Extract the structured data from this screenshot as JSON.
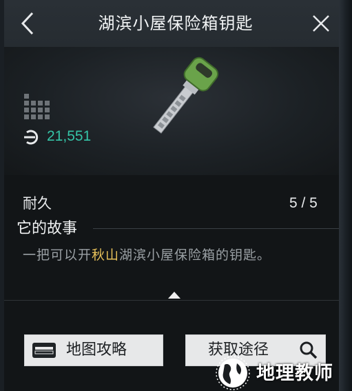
{
  "header": {
    "title": "湖滨小屋保险箱钥匙"
  },
  "item": {
    "price": "21,551",
    "accent_color": "#35c4a7",
    "key_color": "#6aa34a"
  },
  "stats": {
    "durability_label": "耐久",
    "durability_value": "5 / 5"
  },
  "story": {
    "heading": "它的故事",
    "text_before": "一把可以开",
    "text_highlight": "秋山",
    "text_after": "湖滨小屋保险箱的钥匙。",
    "highlight_color": "#e7c15a"
  },
  "buttons": {
    "map_label": "地图攻略",
    "source_label": "获取途径"
  },
  "watermark": {
    "text": "地理教师"
  }
}
